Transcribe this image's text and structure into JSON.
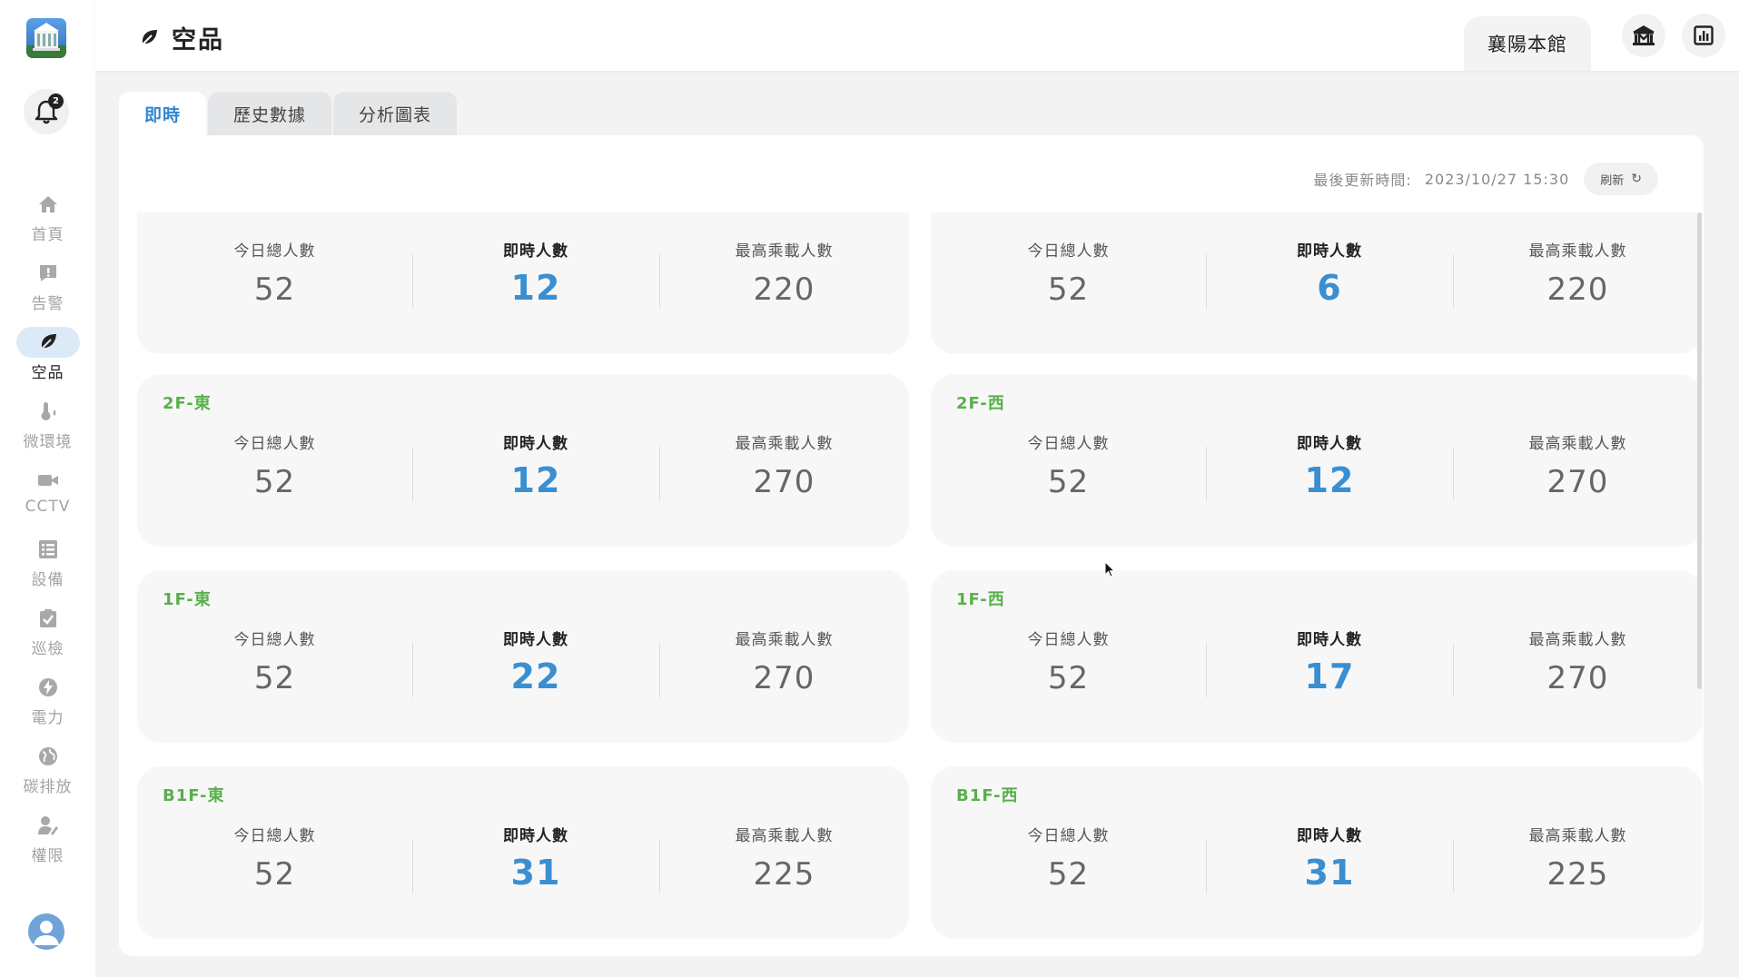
{
  "app": {
    "page_title": "空品",
    "site_name": "襄陽本館",
    "notification_count": "2"
  },
  "sidebar": {
    "items": [
      {
        "label": "首頁",
        "icon": "home-icon"
      },
      {
        "label": "告警",
        "icon": "alert-icon"
      },
      {
        "label": "空品",
        "icon": "leaf-icon",
        "active": true
      },
      {
        "label": "微環境",
        "icon": "thermometer-icon"
      },
      {
        "label": "CCTV",
        "icon": "camera-icon"
      },
      {
        "label": "設備",
        "icon": "list-icon"
      },
      {
        "label": "巡檢",
        "icon": "clipboard-icon"
      },
      {
        "label": "電力",
        "icon": "power-icon"
      },
      {
        "label": "碳排放",
        "icon": "globe-icon"
      },
      {
        "label": "權限",
        "icon": "user-edit-icon"
      }
    ]
  },
  "tabs": [
    {
      "label": "即時",
      "active": true
    },
    {
      "label": "歷史數據"
    },
    {
      "label": "分析圖表"
    }
  ],
  "update": {
    "label": "最後更新時間:",
    "value": "2023/10/27 15:30",
    "refresh_label": "刷新"
  },
  "metric_labels": {
    "total": "今日總人數",
    "live": "即時人數",
    "max": "最高乘載人數"
  },
  "cards": [
    {
      "zone": "",
      "total": "52",
      "live": "12",
      "max": "220"
    },
    {
      "zone": "",
      "total": "52",
      "live": "6",
      "max": "220"
    },
    {
      "zone": "2F-東",
      "total": "52",
      "live": "12",
      "max": "270"
    },
    {
      "zone": "2F-西",
      "total": "52",
      "live": "12",
      "max": "270"
    },
    {
      "zone": "1F-東",
      "total": "52",
      "live": "22",
      "max": "270"
    },
    {
      "zone": "1F-西",
      "total": "52",
      "live": "17",
      "max": "270"
    },
    {
      "zone": "B1F-東",
      "total": "52",
      "live": "31",
      "max": "225"
    },
    {
      "zone": "B1F-西",
      "total": "52",
      "live": "31",
      "max": "225"
    }
  ],
  "colors": {
    "accent_blue": "#3b8fd1",
    "zone_green": "#58b04a",
    "active_nav_bg": "#dceaf8"
  }
}
